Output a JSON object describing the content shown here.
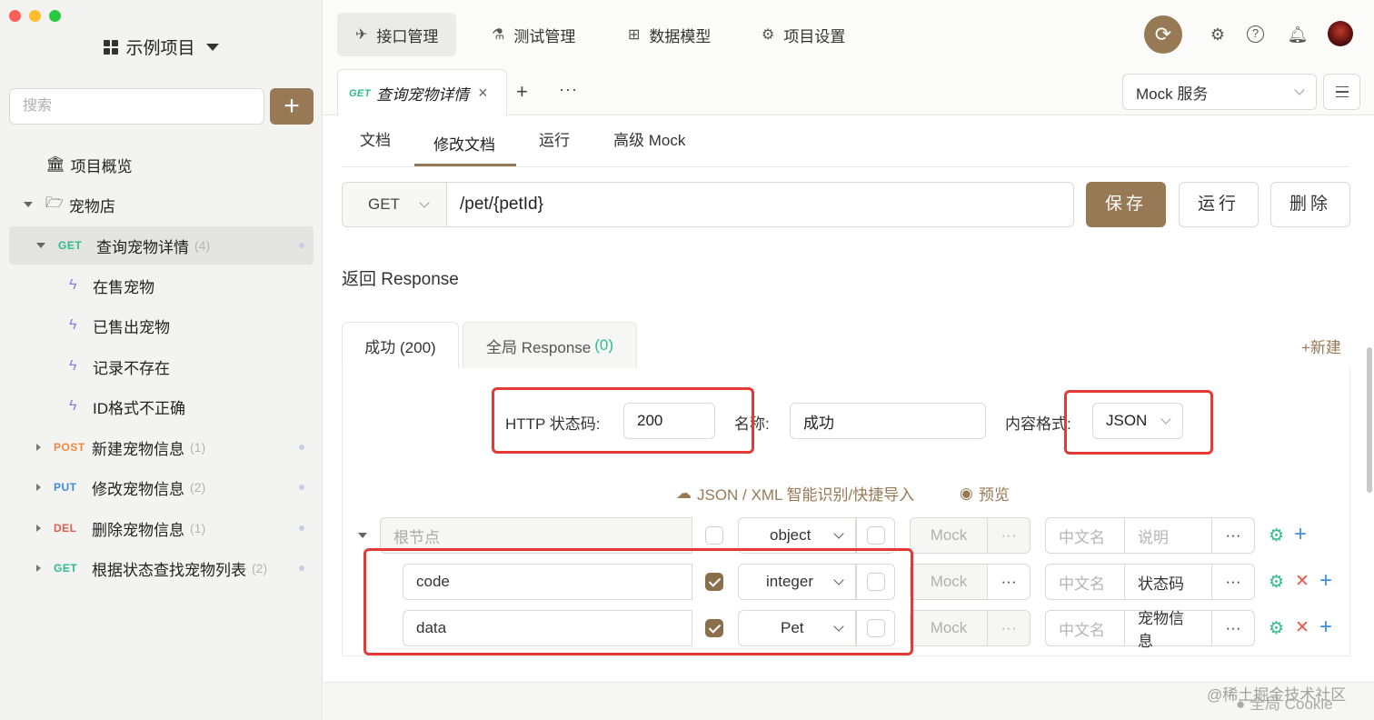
{
  "sidebar": {
    "project_name": "示例项目",
    "search_placeholder": "搜索",
    "add_label": "+",
    "overview": "项目概览",
    "folder": "宠物店",
    "endpoints": [
      {
        "method": "GET",
        "name": "查询宠物详情",
        "count": "(4)"
      },
      {
        "method": "POST",
        "name": "新建宠物信息",
        "count": "(1)"
      },
      {
        "method": "PUT",
        "name": "修改宠物信息",
        "count": "(2)"
      },
      {
        "method": "DEL",
        "name": "删除宠物信息",
        "count": "(1)"
      },
      {
        "method": "GET",
        "name": "根据状态查找宠物列表",
        "count": "(2)"
      }
    ],
    "cases": [
      "在售宠物",
      "已售出宠物",
      "记录不存在",
      "ID格式不正确"
    ]
  },
  "topnav": {
    "tabs": [
      "接口管理",
      "测试管理",
      "数据模型",
      "项目设置"
    ]
  },
  "tabbar": {
    "doc_method": "GET",
    "doc_title": "查询宠物详情",
    "close": "×",
    "plus": "+",
    "more": "···",
    "mock_select": "Mock 服务"
  },
  "subtabs": [
    "文档",
    "修改文档",
    "运行",
    "高级 Mock"
  ],
  "request": {
    "method": "GET",
    "url": "/pet/{petId}",
    "save": "保存",
    "run": "运行",
    "delete": "删除"
  },
  "response": {
    "section_title": "返回 Response",
    "tab_success": "成功 (200)",
    "tab_global": "全局 Response",
    "tab_global_count": "(0)",
    "new_label": "+新建",
    "status_label": "HTTP 状态码:",
    "status_value": "200",
    "name_label": "名称:",
    "name_value": "成功",
    "format_label": "内容格式:",
    "format_value": "JSON",
    "import_label": "JSON / XML 智能识别/快捷导入",
    "preview_label": "预览"
  },
  "schema": {
    "root": {
      "placeholder": "根节点",
      "type": "object",
      "mock": "Mock",
      "cn": "中文名",
      "desc": "说明"
    },
    "rows": [
      {
        "name": "code",
        "type": "integer",
        "mock": "Mock",
        "cn": "中文名",
        "desc": "状态码"
      },
      {
        "name": "data",
        "type": "Pet",
        "mock": "Mock",
        "cn": "中文名",
        "desc": "宠物信息"
      }
    ],
    "more": "···"
  },
  "footer": {
    "cookie": "全局 Cookie",
    "watermark": "@稀土掘金技术社区"
  },
  "colors": {
    "accent": "#977a55",
    "get": "#2ebc8a",
    "post": "#f08a3c",
    "put": "#3f8ce0",
    "del": "#e85a4f",
    "highlight_box": "#e53935"
  }
}
